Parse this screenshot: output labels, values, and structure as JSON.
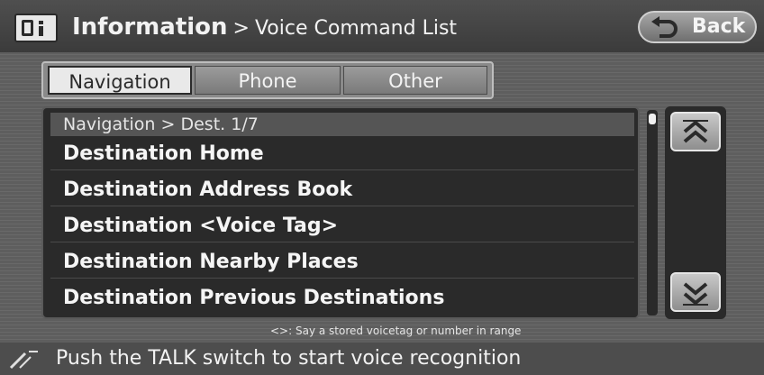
{
  "header": {
    "title_main": "Information",
    "separator": ">",
    "title_sub": "Voice Command List",
    "back_label": "Back",
    "icon": "info-book-icon"
  },
  "tabs": [
    {
      "label": "Navigation",
      "active": true
    },
    {
      "label": "Phone",
      "active": false
    },
    {
      "label": "Other",
      "active": false
    }
  ],
  "list": {
    "header": "Navigation > Dest. 1/7",
    "items": [
      "Destination Home",
      "Destination Address Book",
      "Destination <Voice Tag>",
      "Destination Nearby Places",
      "Destination Previous Destinations"
    ]
  },
  "scroll": {
    "up_icon": "chevron-double-up-icon",
    "down_icon": "chevron-double-down-icon"
  },
  "footnote": "<>: Say a stored voicetag or number in range",
  "status": {
    "text": "Push the TALK switch to start voice recognition",
    "icon": "talk-switch-icon"
  },
  "colors": {
    "background": "#5e5e5e",
    "panel": "#2a2a2a",
    "active_tab": "#e9e9e9"
  }
}
